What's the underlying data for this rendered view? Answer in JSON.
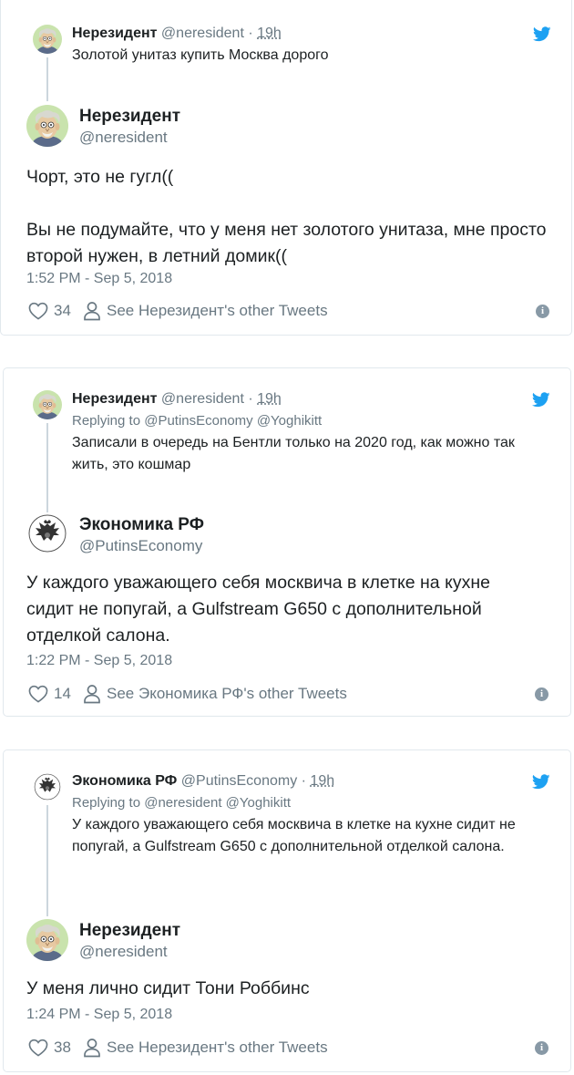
{
  "tweets": [
    {
      "parent": {
        "name": "Нерезидент",
        "handle": "@neresident",
        "dot": "·",
        "time": "19h",
        "replying": "",
        "text": "Золотой унитаз купить Москва дорого"
      },
      "main": {
        "name": "Нерезидент",
        "handle": "@neresident",
        "text_line1": "Чорт, это не гугл((",
        "text_line2": "Вы не подумайте, что у меня нет золотого унитаза, мне просто второй нужен, в летний домик((",
        "timestamp": "1:52 PM - Sep 5, 2018",
        "likes": "34",
        "other_tweets": "See Нерезидент's other Tweets"
      }
    },
    {
      "parent": {
        "name": "Нерезидент",
        "handle": "@neresident",
        "dot": "·",
        "time": "19h",
        "replying": "Replying to @PutinsEconomy @Yoghikitt",
        "text": "Записали в очередь на Бентли только на 2020 год, как можно так жить, это кошмар"
      },
      "main": {
        "name": "Экономика РФ",
        "handle": "@PutinsEconomy",
        "text_line1": "У каждого уважающего себя москвича в клетке на кухне сидит не попугай, а Gulfstream G650 с дополнительной отделкой салона.",
        "timestamp": "1:22 PM - Sep 5, 2018",
        "likes": "14",
        "other_tweets": "See Экономика РФ's other Tweets"
      }
    },
    {
      "parent": {
        "name": "Экономика РФ",
        "handle": "@PutinsEconomy",
        "dot": "·",
        "time": "19h",
        "replying": "Replying to @neresident @Yoghikitt",
        "text": "У каждого уважающего себя москвича в клетке на кухне сидит не попугай, а Gulfstream G650 с дополнительной отделкой салона."
      },
      "main": {
        "name": "Нерезидент",
        "handle": "@neresident",
        "text_line1": "У меня лично сидит Тони Роббинс",
        "timestamp": "1:24 PM - Sep 5, 2018",
        "likes": "38",
        "other_tweets": "See Нерезидент's other Tweets"
      }
    }
  ],
  "colors": {
    "twitter_blue": "#1da1f2",
    "secondary_text": "#697882",
    "border": "#e1e8ed"
  },
  "icons": {
    "bird": "twitter-bird-icon",
    "heart": "heart-icon",
    "person": "person-icon",
    "info": "info-icon"
  }
}
